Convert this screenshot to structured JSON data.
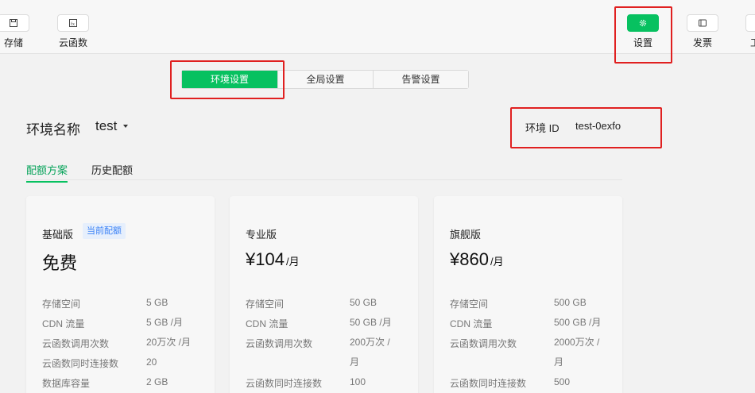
{
  "toolbar": {
    "left": [
      {
        "label": "存储",
        "icon": "save-icon"
      },
      {
        "label": "云函数",
        "icon": "function-icon"
      }
    ],
    "right": [
      {
        "label": "设置",
        "icon": "gear-icon"
      },
      {
        "label": "发票",
        "icon": "invoice-icon"
      },
      {
        "label": "工",
        "icon": "tool-icon"
      }
    ]
  },
  "segments": [
    "环境设置",
    "全局设置",
    "告警设置"
  ],
  "env": {
    "name_label": "环境名称",
    "name_value": "test",
    "id_label": "环境 ID",
    "id_value": "test-0exfo"
  },
  "subtabs": [
    "配额方案",
    "历史配额"
  ],
  "plans": [
    {
      "name": "基础版",
      "badge": "当前配额",
      "price": "免费",
      "unit": "",
      "specs": [
        {
          "label": "存储空间",
          "value": "5 GB"
        },
        {
          "label": "CDN 流量",
          "value": "5 GB /月"
        },
        {
          "label": "云函数调用次数",
          "value": "20万次 /月"
        },
        {
          "label": "云函数同时连接数",
          "value": "20"
        },
        {
          "label": "数据库容量",
          "value": "2 GB"
        }
      ]
    },
    {
      "name": "专业版",
      "badge": "",
      "price": "¥104",
      "unit": "/月",
      "specs": [
        {
          "label": "存储空间",
          "value": "50 GB"
        },
        {
          "label": "CDN 流量",
          "value": "50 GB /月"
        },
        {
          "label": "云函数调用次数",
          "value": "200万次 /月"
        },
        {
          "label": "云函数同时连接数",
          "value": "100"
        }
      ]
    },
    {
      "name": "旗舰版",
      "badge": "",
      "price": "¥860",
      "unit": "/月",
      "specs": [
        {
          "label": "存储空间",
          "value": "500 GB"
        },
        {
          "label": "CDN 流量",
          "value": "500 GB /月"
        },
        {
          "label": "云函数调用次数",
          "value": "2000万次 /月"
        },
        {
          "label": "云函数同时连接数",
          "value": "500"
        }
      ]
    }
  ],
  "colors": {
    "accent": "#07c160",
    "highlight": "#e02020"
  }
}
